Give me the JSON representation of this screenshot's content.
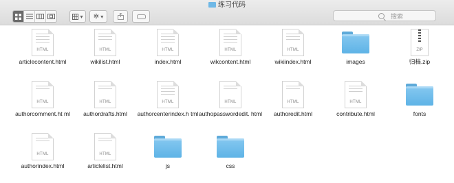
{
  "window": {
    "title": "练习代码"
  },
  "toolbar": {
    "search_placeholder": "搜索",
    "view_modes": [
      "icon-view",
      "list-view",
      "column-view",
      "cover-flow-view"
    ]
  },
  "items": [
    {
      "name": "articlecontent.html",
      "type": "html",
      "tag": "HTML"
    },
    {
      "name": "wikilist.html",
      "type": "html",
      "tag": "HTML"
    },
    {
      "name": "index.html",
      "type": "html",
      "tag": "HTML"
    },
    {
      "name": "wikcontent.html",
      "type": "html",
      "tag": "HTML"
    },
    {
      "name": "wikiindex.html",
      "type": "html",
      "tag": "HTML"
    },
    {
      "name": "images",
      "type": "folder"
    },
    {
      "name": "归档.zip",
      "type": "zip",
      "tag": "ZIP"
    },
    {
      "name": "authorcomment.ht ml",
      "type": "html",
      "tag": "HTML"
    },
    {
      "name": "authordrafts.html",
      "type": "html",
      "tag": "HTML"
    },
    {
      "name": "authorcenterindex.h tml",
      "type": "html",
      "tag": "HTML"
    },
    {
      "name": "authopasswordedit. html",
      "type": "html",
      "tag": "HTML"
    },
    {
      "name": "authoredit.html",
      "type": "html",
      "tag": "HTML"
    },
    {
      "name": "contribute.html",
      "type": "html",
      "tag": "HTML"
    },
    {
      "name": "fonts",
      "type": "folder"
    },
    {
      "name": "authorindex.html",
      "type": "html",
      "tag": "HTML"
    },
    {
      "name": "articlelist.html",
      "type": "html",
      "tag": "HTML"
    },
    {
      "name": "js",
      "type": "folder"
    },
    {
      "name": "css",
      "type": "folder"
    }
  ]
}
